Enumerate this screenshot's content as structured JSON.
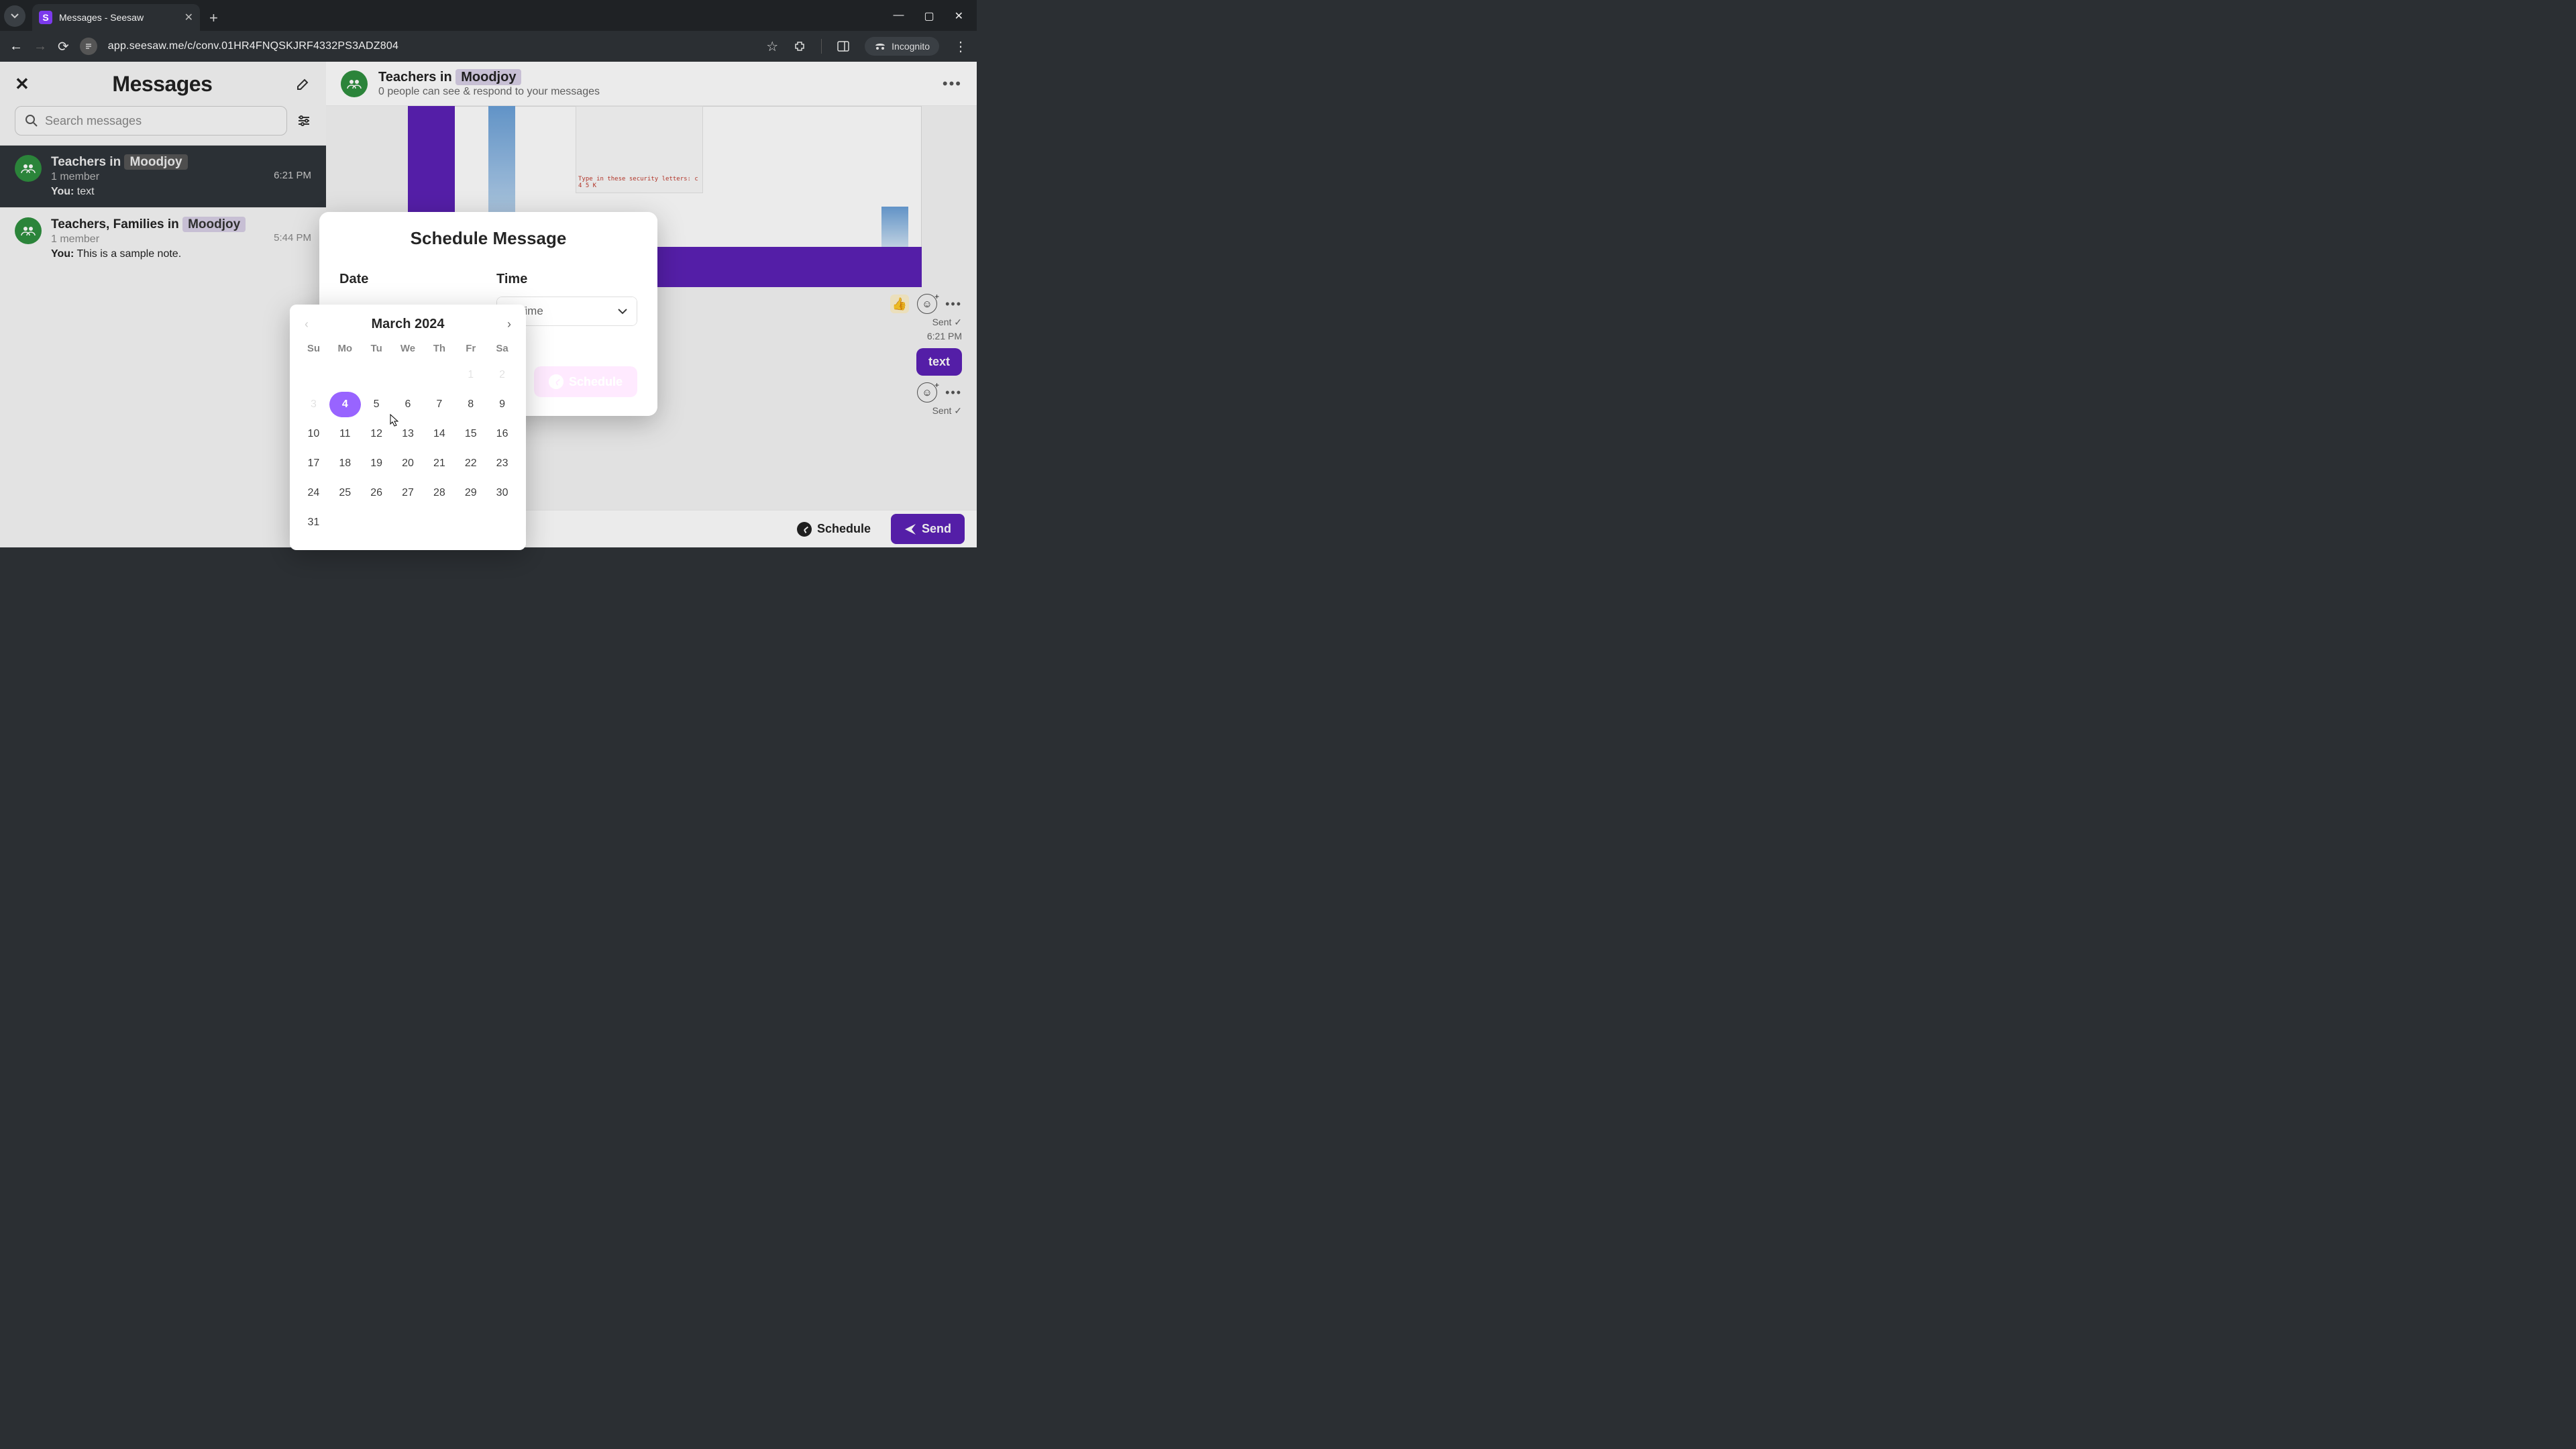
{
  "browser": {
    "tab_title": "Messages - Seesaw",
    "url": "app.seesaw.me/c/conv.01HR4FNQSKJRF4332PS3ADZ804",
    "incognito_label": "Incognito"
  },
  "sidebar": {
    "title": "Messages",
    "search_placeholder": "Search messages",
    "items": [
      {
        "title_prefix": "Teachers in ",
        "title_chip": "Moodjoy",
        "members": "1 member",
        "time": "6:21 PM",
        "preview_label": "You:",
        "preview_text": " text",
        "selected": true
      },
      {
        "title_prefix": "Teachers, Families in ",
        "title_chip": "Moodjoy",
        "members": "1 member",
        "time": "5:44 PM",
        "preview_label": "You:",
        "preview_text": " This is a sample note.",
        "selected": false
      }
    ]
  },
  "chat": {
    "title_prefix": "Teachers in ",
    "title_chip": "Moodjoy",
    "subtitle": "0 people can see & respond to your messages",
    "attachment_caption_prefix": "Type in these security letters:  ",
    "attachment_caption_code": "c 4 5 K",
    "sent_label_1": "Sent ✓",
    "time_1": "6:21 PM",
    "bubble_text": "text",
    "sent_label_2": "Sent ✓",
    "schedule_button": "Schedule",
    "send_button": "Send"
  },
  "modal": {
    "title": "Schedule Message",
    "date_label": "Date",
    "time_label": "Time",
    "time_placeholder": "Select Time",
    "time_placeholder_clipped": "ct Time",
    "submit_label": "Schedule"
  },
  "datepicker": {
    "month_label": "March 2024",
    "dow": [
      "Su",
      "Mo",
      "Tu",
      "We",
      "Th",
      "Fr",
      "Sa"
    ],
    "weeks": [
      [
        "",
        "",
        "",
        "",
        "",
        "1",
        "2"
      ],
      [
        "3",
        "4",
        "5",
        "6",
        "7",
        "8",
        "9"
      ],
      [
        "10",
        "11",
        "12",
        "13",
        "14",
        "15",
        "16"
      ],
      [
        "17",
        "18",
        "19",
        "20",
        "21",
        "22",
        "23"
      ],
      [
        "24",
        "25",
        "26",
        "27",
        "28",
        "29",
        "30"
      ],
      [
        "31",
        "",
        "",
        "",
        "",
        "",
        ""
      ]
    ],
    "dim_days": [
      "1",
      "2",
      "3"
    ],
    "selected_day": "4"
  }
}
